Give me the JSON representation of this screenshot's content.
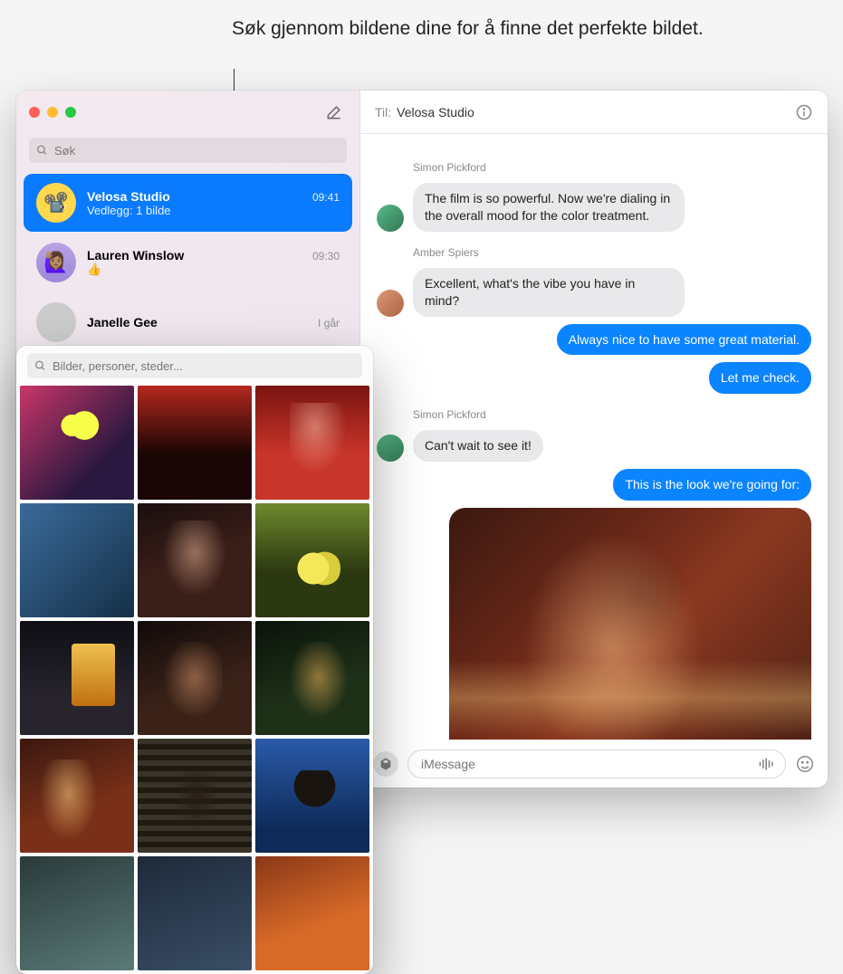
{
  "annotation": {
    "text": "Søk gjennom bildene dine for å finne det perfekte bildet."
  },
  "sidebar": {
    "search_placeholder": "Søk",
    "conversations": [
      {
        "name": "Velosa Studio",
        "subtitle": "Vedlegg: 1 bilde",
        "time": "09:41",
        "avatar_emoji": "📽️",
        "active": true
      },
      {
        "name": "Lauren Winslow",
        "subtitle": "👍",
        "time": "09:30",
        "avatar_emoji": "🙋🏽‍♀️",
        "active": false
      },
      {
        "name": "Janelle Gee",
        "subtitle": "",
        "time": "I går",
        "avatar_emoji": "",
        "active": false
      }
    ]
  },
  "header": {
    "to_label": "Til:",
    "recipient": "Velosa Studio"
  },
  "thread": {
    "senders": {
      "simon": "Simon Pickford",
      "amber": "Amber Spiers"
    },
    "messages": {
      "m1": "The film is so powerful. Now we're dialing in the overall mood for the color treatment.",
      "m2": "Excellent, what's the vibe you have in mind?",
      "m3": "Always nice to have some great material.",
      "m4": "Let me check.",
      "m5": "Can't wait to see it!",
      "m6": "This is the look we're going for:"
    }
  },
  "composer": {
    "placeholder": "iMessage"
  },
  "picker": {
    "search_placeholder": "Bilder, personer, steder..."
  },
  "icons": {
    "compose": "compose-icon",
    "search": "search-icon",
    "info": "info-icon",
    "apps": "apps-icon",
    "mic": "waveform-icon",
    "emoji": "emoji-icon"
  }
}
